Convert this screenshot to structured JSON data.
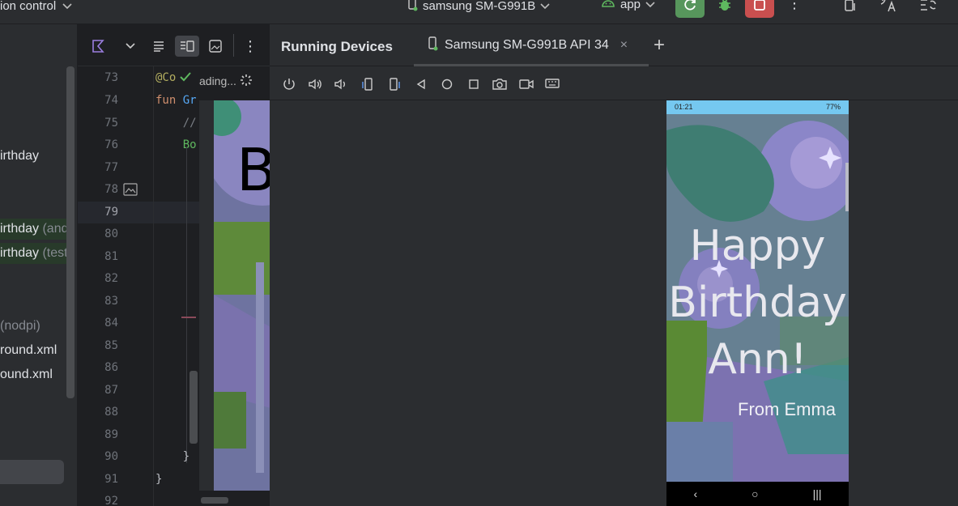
{
  "topbar": {
    "version_control_label": "ion control",
    "device_label": "samsung SM-G991B",
    "config_label": "app"
  },
  "project": {
    "rows": [
      {
        "label": "irthday",
        "suffix": ""
      },
      {
        "label": "irthday",
        "suffix": " (and"
      },
      {
        "label": "irthday",
        "suffix": " (test"
      },
      {
        "label": "",
        "suffix": "(nodpi)"
      },
      {
        "label": "round.xml",
        "suffix": ""
      },
      {
        "label": "ound.xml",
        "suffix": ""
      }
    ]
  },
  "editor": {
    "line_numbers": [
      "73",
      "74",
      "75",
      "76",
      "77",
      "78",
      "79",
      "80",
      "81",
      "82",
      "83",
      "84",
      "85",
      "86",
      "87",
      "88",
      "89",
      "90",
      "91",
      "92"
    ],
    "current_line": "79",
    "code": {
      "l73": "@Co",
      "l74_kw": "fun",
      "l74_fn": " Gr",
      "l75": "    //",
      "l76": "    Bo",
      "l90": "    }",
      "l91": "}"
    },
    "preview_loading": "ading...",
    "preview_letter": "B"
  },
  "running_devices": {
    "title": "Running Devices",
    "tab_label": "Samsung SM-G991B API 34",
    "status_time": "01:21",
    "status_battery": "77%",
    "greeting_lines": [
      "Happy",
      "Birthday",
      "Ann!"
    ],
    "signature": "From Emma"
  },
  "colors": {
    "run_button": "#57965c",
    "stop_button": "#c94f4f",
    "status_bar": "#75c8f0"
  }
}
